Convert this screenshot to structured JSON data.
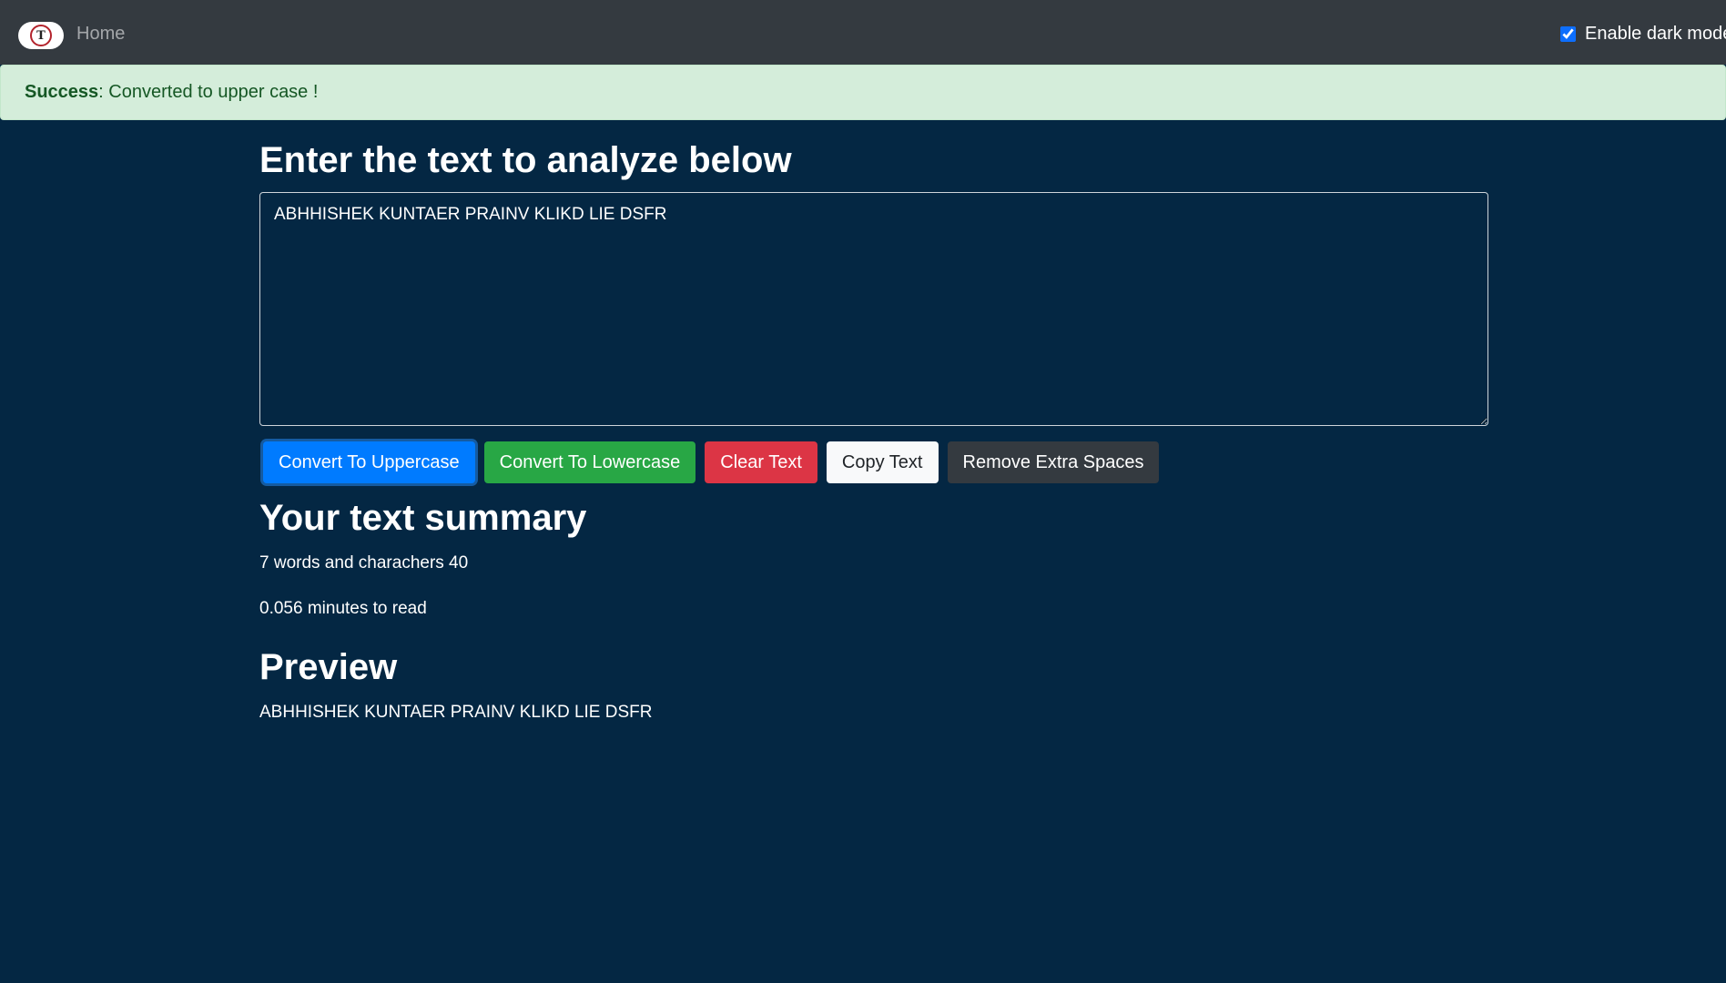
{
  "navbar": {
    "brand_letter": "T",
    "home_label": "Home",
    "dark_mode_label": "Enable dark mode",
    "dark_mode_checked": true
  },
  "alert": {
    "type_label": "Success",
    "message": ": Converted to upper case !"
  },
  "main": {
    "heading": "Enter the text to analyze below",
    "textarea_value": "ABHHISHEK KUNTAER PRAINV KLIKD LIE DSFR",
    "buttons": {
      "uppercase": "Convert To Uppercase",
      "lowercase": "Convert To Lowercase",
      "clear": "Clear Text",
      "copy": "Copy Text",
      "remove_spaces": "Remove Extra Spaces"
    },
    "summary_heading": "Your text summary",
    "word_char_stat": "7 words and charachers 40",
    "read_time": "0.056 minutes to read",
    "preview_heading": "Preview",
    "preview_text": "ABHHISHEK KUNTAER PRAINV KLIKD LIE DSFR"
  },
  "colors": {
    "background": "#042743",
    "navbar": "#343a40",
    "alert_bg": "#d4edda",
    "alert_text": "#155724",
    "primary": "#007bff",
    "success": "#28a745",
    "danger": "#dc3545",
    "light": "#f8f9fa",
    "dark": "#343a40"
  }
}
